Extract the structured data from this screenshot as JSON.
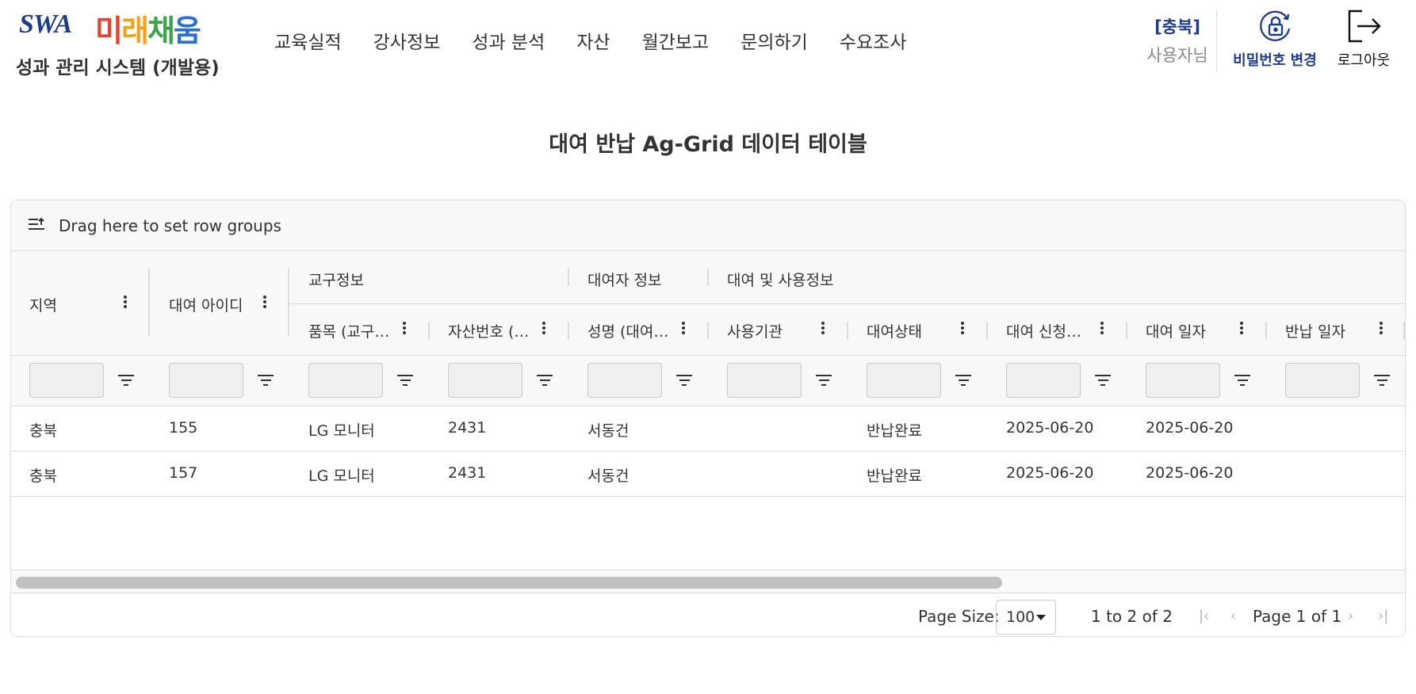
{
  "logo": {
    "brand_en": "SWA",
    "brand_kr": [
      "미",
      "래",
      "채",
      "움"
    ]
  },
  "system_title": "성과 관리 시스템 (개발용)",
  "nav": [
    "교육실적",
    "강사정보",
    "성과 분석",
    "자산",
    "월간보고",
    "문의하기",
    "수요조사"
  ],
  "user": {
    "region": "[충북]",
    "name": "사용자님"
  },
  "actions": {
    "change_password": "비밀번호 변경",
    "logout": "로그아웃"
  },
  "page_title": "대여 반납 Ag-Grid 데이터 테이블",
  "grid": {
    "group_panel_text": "Drag here to set row groups",
    "column_groups": [
      "교구정보",
      "대여자 정보",
      "대여 및 사용정보"
    ],
    "columns": [
      "지역",
      "대여 아이디",
      "품목 (교구…",
      "자산번호 (…",
      "성명 (대여…",
      "사용기관",
      "대여상태",
      "대여 신청…",
      "대여 일자",
      "반납 일자"
    ],
    "rows": [
      [
        "충북",
        "155",
        "LG 모니터",
        "2431",
        "서동건",
        "",
        "반납완료",
        "2025-06-20",
        "2025-06-20",
        ""
      ],
      [
        "충북",
        "157",
        "LG 모니터",
        "2431",
        "서동건",
        "",
        "반납완료",
        "2025-06-20",
        "2025-06-20",
        ""
      ]
    ],
    "pagination": {
      "page_size_label": "Page Size:",
      "page_size": "100",
      "row_summary": "1 to 2 of 2",
      "page_description": "Page 1 of 1"
    }
  }
}
